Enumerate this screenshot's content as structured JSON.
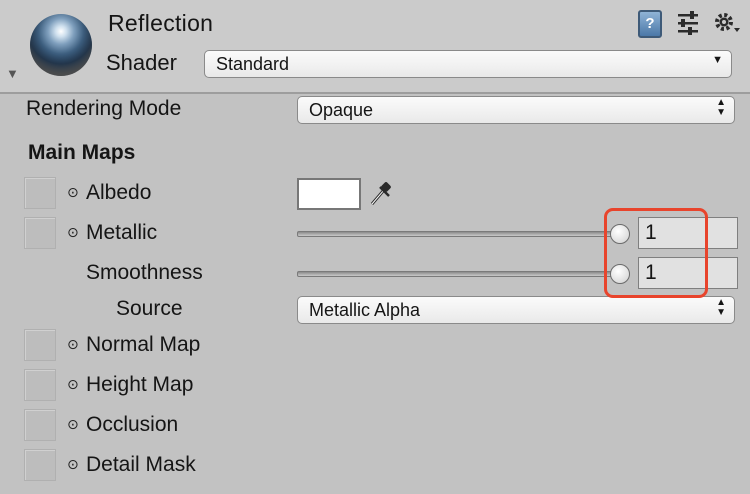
{
  "header": {
    "title": "Reflection",
    "shader_label": "Shader",
    "shader_value": "Standard",
    "icons": [
      "sphere-preview",
      "help-icon",
      "preset-sliders-icon",
      "gear-icon"
    ]
  },
  "rendering_mode": {
    "label": "Rendering Mode",
    "value": "Opaque"
  },
  "main_maps": {
    "heading": "Main Maps",
    "albedo": {
      "label": "Albedo",
      "color": "#ffffff"
    },
    "metallic": {
      "label": "Metallic",
      "value": "1",
      "fraction": 1.0
    },
    "smoothness": {
      "label": "Smoothness",
      "value": "1",
      "fraction": 1.0
    },
    "source": {
      "label": "Source",
      "value": "Metallic Alpha"
    },
    "normal_map": {
      "label": "Normal Map"
    },
    "height_map": {
      "label": "Height Map"
    },
    "occlusion": {
      "label": "Occlusion"
    },
    "detail_mask": {
      "label": "Detail Mask"
    }
  },
  "colors": {
    "highlight": "#e8442c",
    "panel": "#c2c2c2"
  }
}
